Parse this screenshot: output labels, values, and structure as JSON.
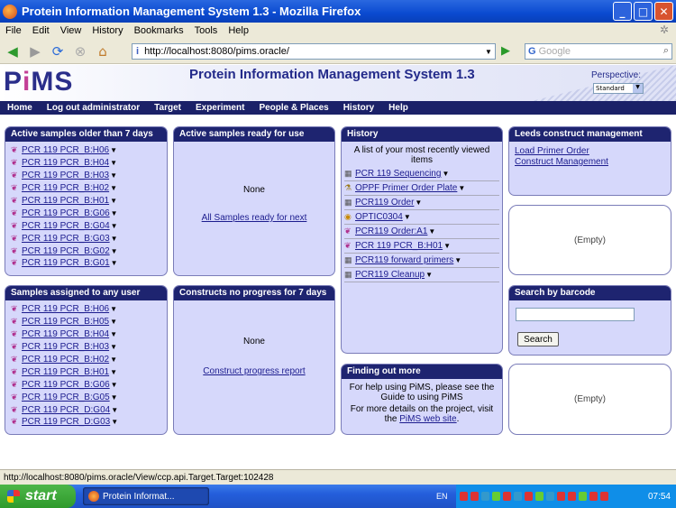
{
  "window": {
    "title": "Protein Information Management System 1.3 - Mozilla Firefox",
    "buttons": {
      "minimize": "_",
      "maximize": "□",
      "close": "✕"
    }
  },
  "menu": [
    "File",
    "Edit",
    "View",
    "History",
    "Bookmarks",
    "Tools",
    "Help"
  ],
  "toolbar": {
    "url": "http://localhost:8080/pims.oracle/",
    "search_placeholder": "Google",
    "search_engine": "G"
  },
  "app": {
    "logo": {
      "part1": "P",
      "part2": "i",
      "part3": "MS"
    },
    "title": "Protein Information Management System 1.3",
    "perspective_label": "Perspective:",
    "perspective_value": "Standard"
  },
  "nav": [
    "Home",
    "Log out administrator",
    "Target",
    "Experiment",
    "People & Places",
    "History",
    "Help"
  ],
  "panels": {
    "active_older": {
      "title": "Active samples older than 7 days",
      "items": [
        "PCR 119 PCR_B:H06",
        "PCR 119 PCR_B:H04",
        "PCR 119 PCR_B:H03",
        "PCR 119 PCR_B:H02",
        "PCR 119 PCR_B:H01",
        "PCR 119 PCR_B:G06",
        "PCR 119 PCR_B:G04",
        "PCR 119 PCR_B:G03",
        "PCR 119 PCR_B:G02",
        "PCR 119 PCR_B:G01"
      ]
    },
    "active_ready": {
      "title": "Active samples ready for use",
      "none": "None",
      "link": "All Samples ready for next"
    },
    "history": {
      "title": "History",
      "intro": "A list of your most recently viewed items",
      "items": [
        {
          "icon": "table-icon",
          "label": "PCR 119 Sequencing"
        },
        {
          "icon": "plate-icon",
          "label": "OPPF Primer Order Plate"
        },
        {
          "icon": "table-icon",
          "label": "PCR119 Order"
        },
        {
          "icon": "target-icon",
          "label": "OPTIC0304"
        },
        {
          "icon": "tube-icon",
          "label": "PCR119 Order:A1"
        },
        {
          "icon": "tube-icon",
          "label": "PCR 119 PCR_B:H01"
        },
        {
          "icon": "table-icon",
          "label": "PCR119 forward primers"
        },
        {
          "icon": "table-icon",
          "label": "PCR119 Cleanup"
        }
      ]
    },
    "leeds": {
      "title": "Leeds construct management",
      "links": [
        "Load Primer Order",
        "Construct Management"
      ]
    },
    "empty1": {
      "text": "(Empty)"
    },
    "assigned": {
      "title": "Samples assigned to any user",
      "items": [
        "PCR 119 PCR_B:H06",
        "PCR 119 PCR_B:H05",
        "PCR 119 PCR_B:H04",
        "PCR 119 PCR_B:H03",
        "PCR 119 PCR_B:H02",
        "PCR 119 PCR_B:H01",
        "PCR 119 PCR_B:G06",
        "PCR 119 PCR_B:G05",
        "PCR 119 PCR_D:G04",
        "PCR 119 PCR_D:G03"
      ]
    },
    "constructs": {
      "title": "Constructs no progress for 7 days",
      "none": "None",
      "link": "Construct progress report"
    },
    "barcode": {
      "title": "Search by barcode",
      "button": "Search"
    },
    "finding": {
      "title": "Finding out more",
      "line1": "For help using PiMS, please see the Guide to using PiMS",
      "line2": "For more details on the project, visit the ",
      "line2_link": "PiMS web site",
      "line2_end": "."
    },
    "empty2": {
      "text": "(Empty)"
    }
  },
  "status": "http://localhost:8080/pims.oracle/View/ccp.api.Target.Target:102428",
  "taskbar": {
    "start": "start",
    "task": "Protein Informat...",
    "lang": "EN",
    "clock": "07:54"
  }
}
